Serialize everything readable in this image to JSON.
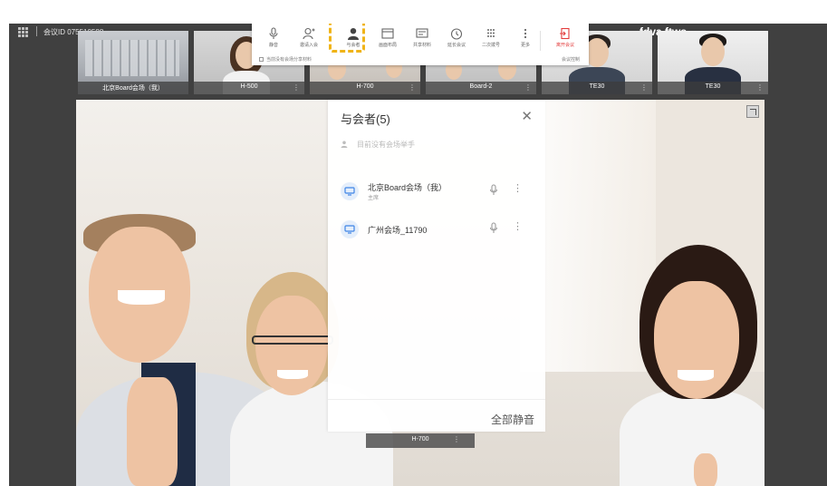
{
  "topbar": {
    "meeting_id": "会议ID 075510588",
    "user_name": "fdva ftws"
  },
  "thumbnails": [
    {
      "label": "北京Board会场（我）"
    },
    {
      "label": "H-500"
    },
    {
      "label": "H-700"
    },
    {
      "label": "Board-2"
    },
    {
      "label": "TE30"
    },
    {
      "label": "TE30"
    }
  ],
  "toolbar": {
    "items": [
      {
        "label": "静音",
        "icon": "microphone-icon"
      },
      {
        "label": "邀请入会",
        "icon": "invite-user-icon"
      },
      {
        "label": "与会者",
        "icon": "participants-icon"
      },
      {
        "label": "画面布局",
        "icon": "layout-icon"
      },
      {
        "label": "共享材料",
        "icon": "share-icon"
      },
      {
        "label": "延长会议",
        "icon": "clock-icon"
      },
      {
        "label": "二次拨号",
        "icon": "dialpad-icon"
      },
      {
        "label": "更多",
        "icon": "more-icon"
      },
      {
        "label": "离开会议",
        "icon": "leave-icon"
      }
    ],
    "hint_left": "当前没有会场分享材料",
    "hint_right": "会议控制"
  },
  "participants_panel": {
    "title": "与会者(5)",
    "tip": "目前没有会场举手",
    "rows": [
      {
        "name": "北京Board会场（我）",
        "role": "主席"
      },
      {
        "name": "广州会场_11790",
        "role": ""
      }
    ],
    "mute_all": "全部静音"
  },
  "main_video": {
    "caption": "H-700"
  },
  "colors": {
    "leave": "#e23b3b",
    "highlight": "#f0b418",
    "avatar_blue": "#3f84e5"
  }
}
